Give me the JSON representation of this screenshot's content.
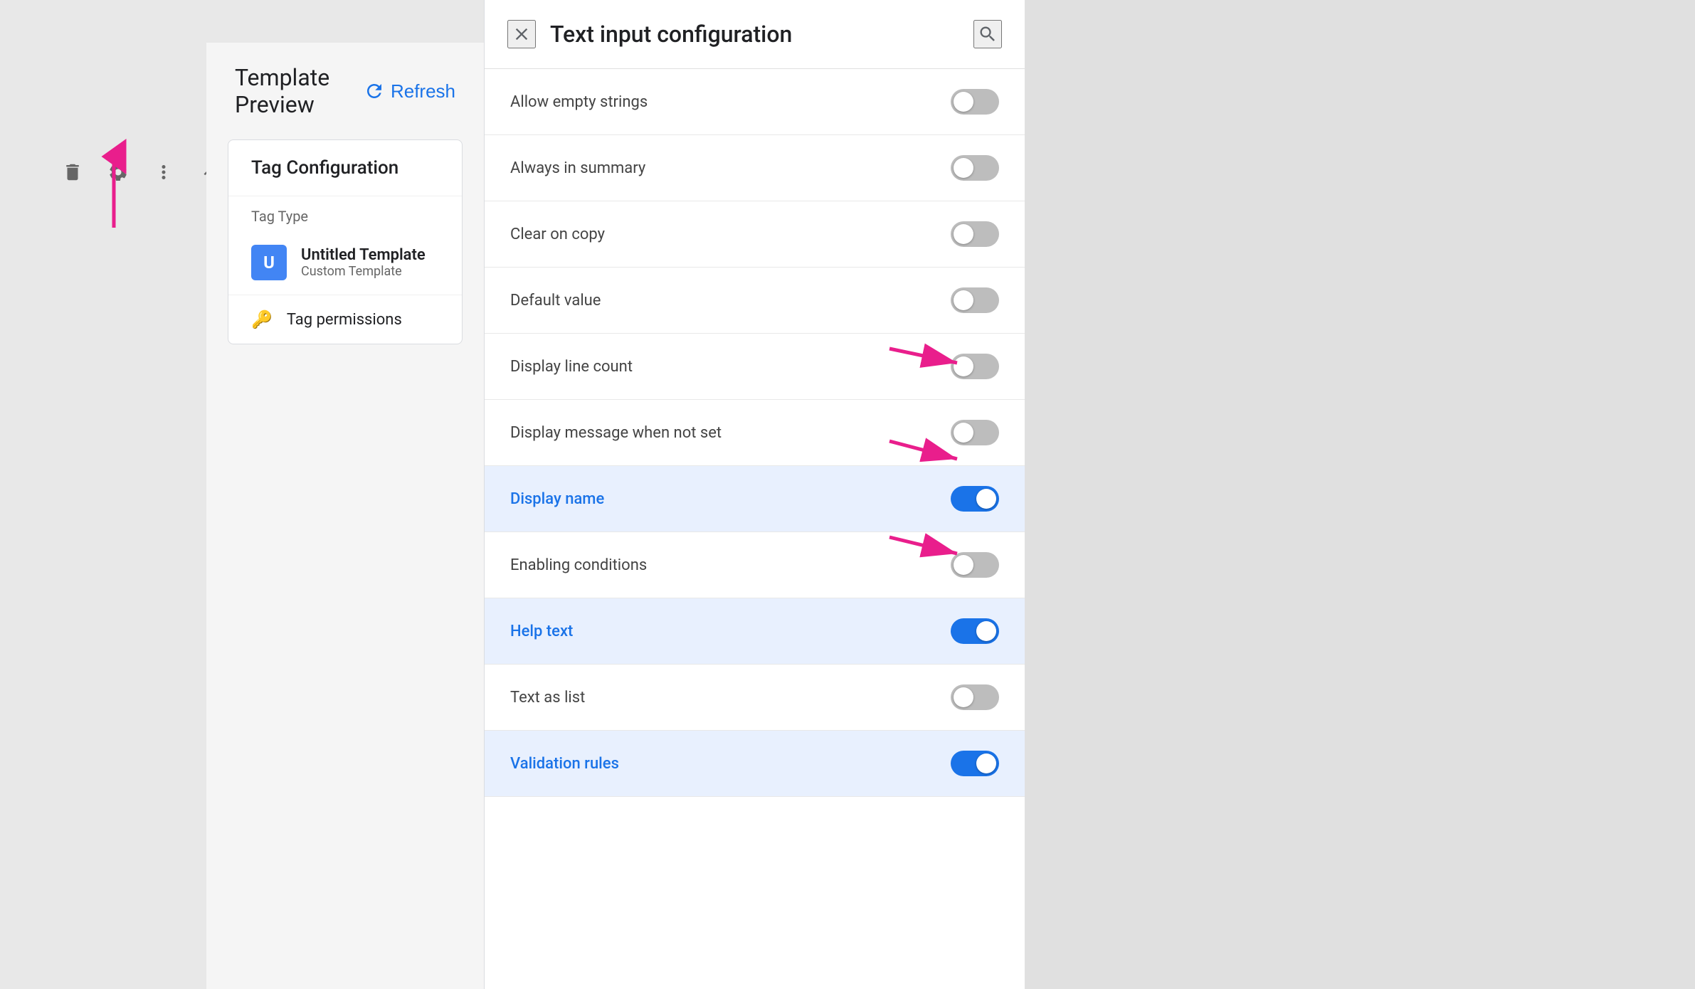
{
  "left_panel": {
    "toolbar": {
      "delete_label": "Delete",
      "settings_label": "Settings",
      "more_label": "More options",
      "collapse_label": "Collapse"
    }
  },
  "template_preview": {
    "title": "Template Preview",
    "refresh_label": "Refresh",
    "tag_config": {
      "header": "Tag Configuration",
      "tag_type_label": "Tag Type",
      "untitled_template": "Untitled Template",
      "custom_template": "Custom Template",
      "tag_permissions": "Tag permissions",
      "tag_icon_letter": "U"
    }
  },
  "config_panel": {
    "title": "Text input configuration",
    "close_label": "×",
    "search_label": "Search",
    "items": [
      {
        "id": "allow-empty-strings",
        "label": "Allow empty strings",
        "enabled": false,
        "highlighted": false
      },
      {
        "id": "always-in-summary",
        "label": "Always in summary",
        "enabled": false,
        "highlighted": false
      },
      {
        "id": "clear-on-copy",
        "label": "Clear on copy",
        "enabled": false,
        "highlighted": false
      },
      {
        "id": "default-value",
        "label": "Default value",
        "enabled": false,
        "highlighted": false
      },
      {
        "id": "display-line-count",
        "label": "Display line count",
        "enabled": false,
        "highlighted": false
      },
      {
        "id": "display-message-when-not-set",
        "label": "Display message when not set",
        "enabled": false,
        "highlighted": false
      },
      {
        "id": "display-name",
        "label": "Display name",
        "enabled": true,
        "highlighted": true
      },
      {
        "id": "enabling-conditions",
        "label": "Enabling conditions",
        "enabled": false,
        "highlighted": false
      },
      {
        "id": "help-text",
        "label": "Help text",
        "enabled": true,
        "highlighted": true
      },
      {
        "id": "text-as-list",
        "label": "Text as list",
        "enabled": false,
        "highlighted": false
      },
      {
        "id": "validation-rules",
        "label": "Validation rules",
        "enabled": true,
        "highlighted": true
      }
    ]
  }
}
